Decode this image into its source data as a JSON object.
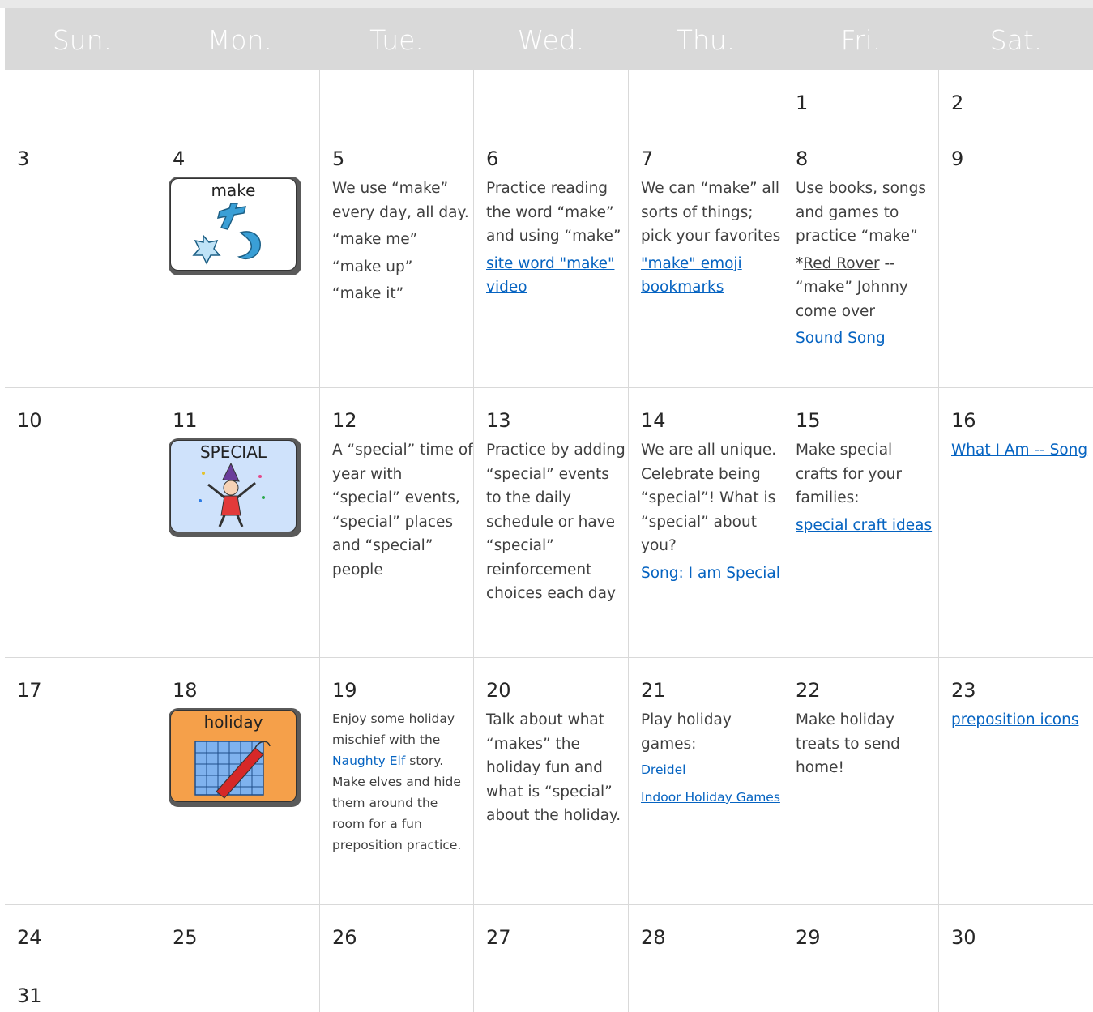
{
  "weekdays": [
    "Sun.",
    "Mon.",
    "Tue.",
    "Wed.",
    "Thu.",
    "Fri.",
    "Sat."
  ],
  "colors": {
    "header_bg": "#d9d9d9",
    "header_text": "#ffffff",
    "link": "#0563c1",
    "grid": "#d9d9d9"
  },
  "days": {
    "d1": "1",
    "d2": "2",
    "d3": "3",
    "d4": "4",
    "d5": "5",
    "d6": "6",
    "d7": "7",
    "d8": "8",
    "d9": "9",
    "d10": "10",
    "d11": "11",
    "d12": "12",
    "d13": "13",
    "d14": "14",
    "d15": "15",
    "d16": "16",
    "d17": "17",
    "d18": "18",
    "d19": "19",
    "d20": "20",
    "d21": "21",
    "d22": "22",
    "d23": "23",
    "d24": "24",
    "d25": "25",
    "d26": "26",
    "d27": "27",
    "d28": "28",
    "d29": "29",
    "d30": "30",
    "d31": "31"
  },
  "icons": {
    "make": {
      "label": "make",
      "name": "make-symbol-icon",
      "bg": "#ffffff"
    },
    "special": {
      "label": "SPECIAL",
      "name": "special-symbol-icon",
      "bg": "#cfe2fb"
    },
    "holiday": {
      "label": "holiday",
      "name": "holiday-symbol-icon",
      "bg": "#f5a04a"
    }
  },
  "entries": {
    "d5": {
      "lines": [
        "We use “make” every day, all day.",
        "“make me”",
        "“make up”",
        "“make it”"
      ]
    },
    "d6": {
      "text": "Practice reading the word “make” and using “make”",
      "link": "site word \"make\" video"
    },
    "d7": {
      "text": "We can “make” all sorts of things; pick your favorites",
      "link": "\"make\" emoji bookmarks"
    },
    "d8": {
      "text": "Use books, songs and games to practice “make”",
      "star": "*",
      "underlined": "Red Rover",
      "rest": " -- “make” Johnny come over",
      "link": "Sound Song"
    },
    "d12": {
      "text": "A “special” time of year with “special” events, “special” places and “special” people"
    },
    "d13": {
      "text": "Practice by adding “special” events to the daily schedule or have “special” reinforcement choices each day"
    },
    "d14": {
      "text": "We are all unique. Celebrate being “special”!  What is “special” about you?",
      "link": "Song: I am Special"
    },
    "d15": {
      "text": "Make special crafts for your families:",
      "link": "special craft ideas"
    },
    "d16": {
      "link": "What I Am -- Song"
    },
    "d19": {
      "before": "Enjoy some holiday mischief with the ",
      "link": "Naughty Elf",
      "after": " story.  Make elves and hide them around the room for a fun preposition practice."
    },
    "d20": {
      "text": "Talk about what “makes” the holiday fun and what is “special” about the holiday."
    },
    "d21": {
      "text": "Play holiday games:",
      "link1": "Dreidel",
      "link2": "Indoor Holiday Games"
    },
    "d22": {
      "text": "Make holiday treats to send home!"
    },
    "d23": {
      "link": "preposition icons"
    }
  }
}
